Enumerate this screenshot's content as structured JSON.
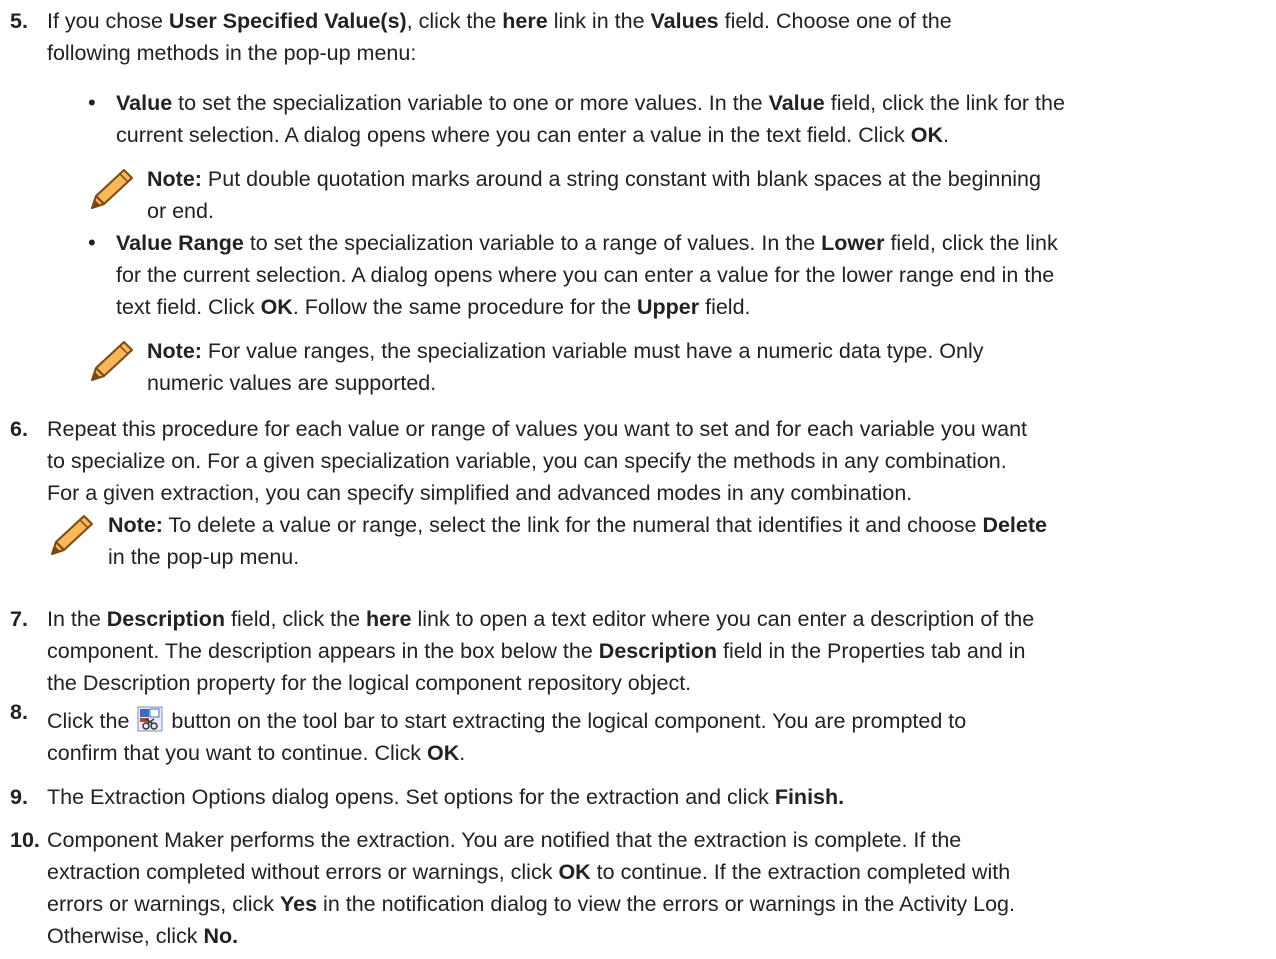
{
  "steps": {
    "s5": {
      "number": "5.",
      "p1": "If you chose ",
      "b1": "User Specified Value(s)",
      "p2": ", click the ",
      "b2": "here",
      "p3": " link in the ",
      "b3": "Values",
      "p4": " field. Choose one of the",
      "line2": "following methods in the pop-up menu:",
      "bullet1": {
        "b1": "Value",
        "p1": " to set the specialization variable to one or more values. In the ",
        "b2": "Value",
        "p2": " field, click the link for the",
        "line2a": "current selection. A dialog opens where you can enter a value in the text field. Click ",
        "b3": "OK",
        "line2b": ".",
        "note": {
          "label": "Note:",
          "line1": " Put double quotation marks around a string constant with blank spaces at the beginning",
          "line2": "or end."
        }
      },
      "bullet2": {
        "b1": "Value Range",
        "p1": " to set the specialization variable to a range of values. In the ",
        "b2": "Lower",
        "p2": " field, click the link",
        "line2": "for the current selection. A dialog opens where you can enter a value for the lower range end in the",
        "line3a": "text field. Click ",
        "b3": "OK",
        "line3b": ". Follow the same procedure for the ",
        "b4": "Upper",
        "line3c": " field.",
        "note": {
          "label": "Note:",
          "line1": " For value ranges, the specialization variable must have a numeric data type. Only",
          "line2": "numeric values are supported."
        }
      }
    },
    "s6": {
      "number": "6.",
      "line1": "Repeat this procedure for each value or range of values you want to set and for each variable you want",
      "line2": "to specialize on. For a given specialization variable, you can specify the methods in any combination.",
      "line3": "For a given extraction, you can specify simplified and advanced modes in any combination.",
      "note": {
        "label": "Note:",
        "line1": " To delete a value or range, select the link for the numeral that identifies it and choose ",
        "b1": "Delete",
        "line2": "in the pop-up menu."
      }
    },
    "s7": {
      "number": "7.",
      "p1": "In the ",
      "b1": "Description",
      "p2": " field, click the ",
      "b2": "here",
      "p3": " link to open a text editor where you can enter a description of the",
      "line2a": "component. The description appears in the box below the ",
      "b3": "Description",
      "line2b": " field in the Properties tab and in",
      "line3": "the Description property for the logical component repository object."
    },
    "s8": {
      "number": "8.",
      "p1": "Click the ",
      "p2": " button on the tool bar to start extracting the logical component. You are prompted to",
      "line2a": "confirm that you want to continue. Click ",
      "b1": "OK",
      "line2b": "."
    },
    "s9": {
      "number": "9.",
      "p1": "The Extraction Options dialog opens. Set options for the extraction and click ",
      "b1": "Finish."
    },
    "s10": {
      "number": "10.",
      "line1": "Component Maker performs the extraction. You are notified that the extraction is complete. If the",
      "line2a": "extraction completed without errors or warnings, click ",
      "b1": "OK",
      "line2b": " to continue. If the extraction completed with",
      "line3a": "errors or warnings, click ",
      "b2": "Yes",
      "line3b": " in the notification dialog to view the errors or warnings in the Activity Log.",
      "line4a": "Otherwise, click ",
      "b3": "No."
    }
  },
  "icons": {
    "note_icon": "pencil-icon",
    "toolbar_icon": "extract-component-icon"
  },
  "colors": {
    "text": "#222222",
    "pencil_orange": "#F29A2E",
    "pencil_dark": "#7A4A12"
  }
}
